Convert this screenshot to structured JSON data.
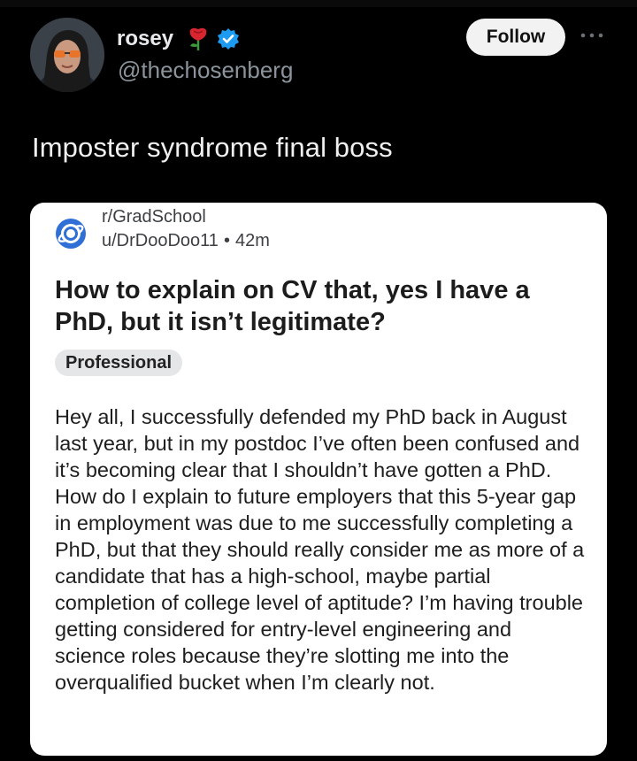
{
  "tweet": {
    "author": {
      "display_name": "rosey",
      "emoji_icon": "rose-icon",
      "verified_icon": "verified-badge-icon",
      "handle": "@thechosenberg"
    },
    "follow_label": "Follow",
    "more_icon": "ellipsis-icon",
    "text": "Imposter syndrome final boss"
  },
  "embedded_post": {
    "platform_icon": "reddit-icon",
    "subreddit": "r/GradSchool",
    "user": "u/DrDooDoo11",
    "separator": "•",
    "age": "42m",
    "title": "How to explain on CV that, yes I have a PhD, but it isn’t legitimate?",
    "flair": "Professional",
    "body": "Hey all, I successfully defended my PhD back in August last year, but in my postdoc I’ve often been confused and it’s becoming clear that I shouldn’t have gotten a PhD. How do I explain to future employers that this 5-year gap in employment was due to me successfully completing a PhD, but that they should really consider me as more of a candidate that has a high-school, maybe partial completion of college level of aptitude? I’m having trouble getting considered for entry-level engineering and science roles because they’re slotting me into the overqualified bucket when I’m clearly not."
  },
  "colors": {
    "background": "#000000",
    "card_background": "#ffffff",
    "handle_gray": "#8b949c",
    "verified_blue": "#1d9bf0",
    "reddit_blue": "#2f6fd6",
    "flair_gray": "#e4e6e8"
  }
}
